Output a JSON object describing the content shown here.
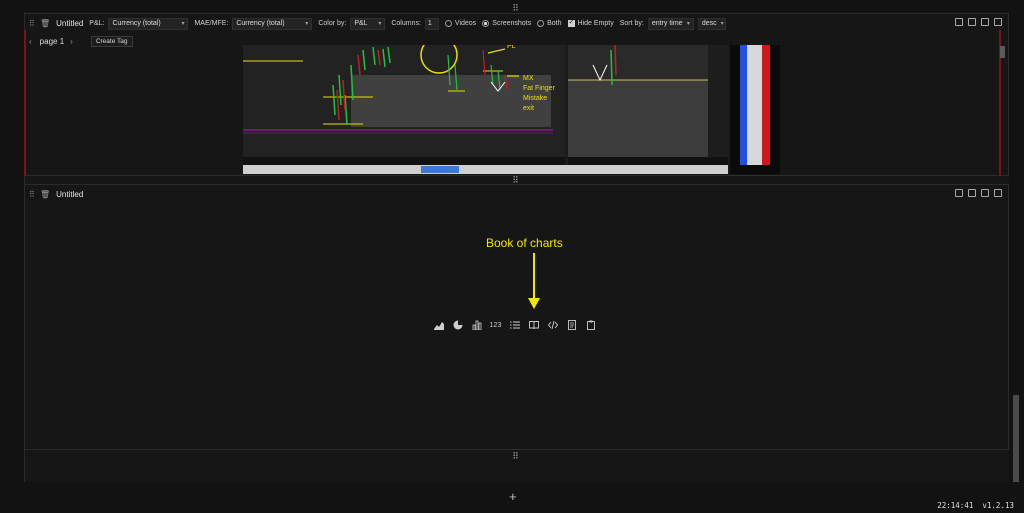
{
  "top_panel": {
    "title": "Untitled",
    "pnl_label": "P&L:",
    "pnl_value": "Currency (total)",
    "maemfe_label": "MAE/MFE:",
    "maemfe_value": "Currency (total)",
    "colorby_label": "Color by:",
    "colorby_value": "P&L",
    "columns_label": "Columns:",
    "columns_value": "1",
    "media_options": [
      "Videos",
      "Screenshots",
      "Both"
    ],
    "media_selected": "Screenshots",
    "hide_empty_label": "Hide Empty",
    "hide_empty_checked": true,
    "sortby_label": "Sort by:",
    "sortby_value": "entry time",
    "order_value": "desc",
    "page_label": "page 1",
    "create_tag_label": "Create Tag"
  },
  "screenshot": {
    "annotation_lines": [
      "MX",
      "Fat Finger",
      "Mistake",
      "exit"
    ],
    "top_label": "PL"
  },
  "bottom_panel": {
    "title": "Untitled",
    "annotation": "Book of charts",
    "toolbar_items": [
      {
        "name": "area-chart-icon",
        "glyph": ""
      },
      {
        "name": "pie-chart-icon",
        "glyph": ""
      },
      {
        "name": "bar-chart-icon",
        "glyph": ""
      },
      {
        "name": "number-icon",
        "glyph": "123"
      },
      {
        "name": "list-icon",
        "glyph": ""
      },
      {
        "name": "book-icon",
        "glyph": ""
      },
      {
        "name": "code-icon",
        "glyph": ""
      },
      {
        "name": "document-icon",
        "glyph": ""
      },
      {
        "name": "clipboard-icon",
        "glyph": ""
      }
    ]
  },
  "status": {
    "time": "22:14:41",
    "version": "v1.2.13"
  },
  "colors": {
    "accent_yellow": "#f2e600",
    "alert_red": "#c02020",
    "chart_green": "#20c040"
  }
}
